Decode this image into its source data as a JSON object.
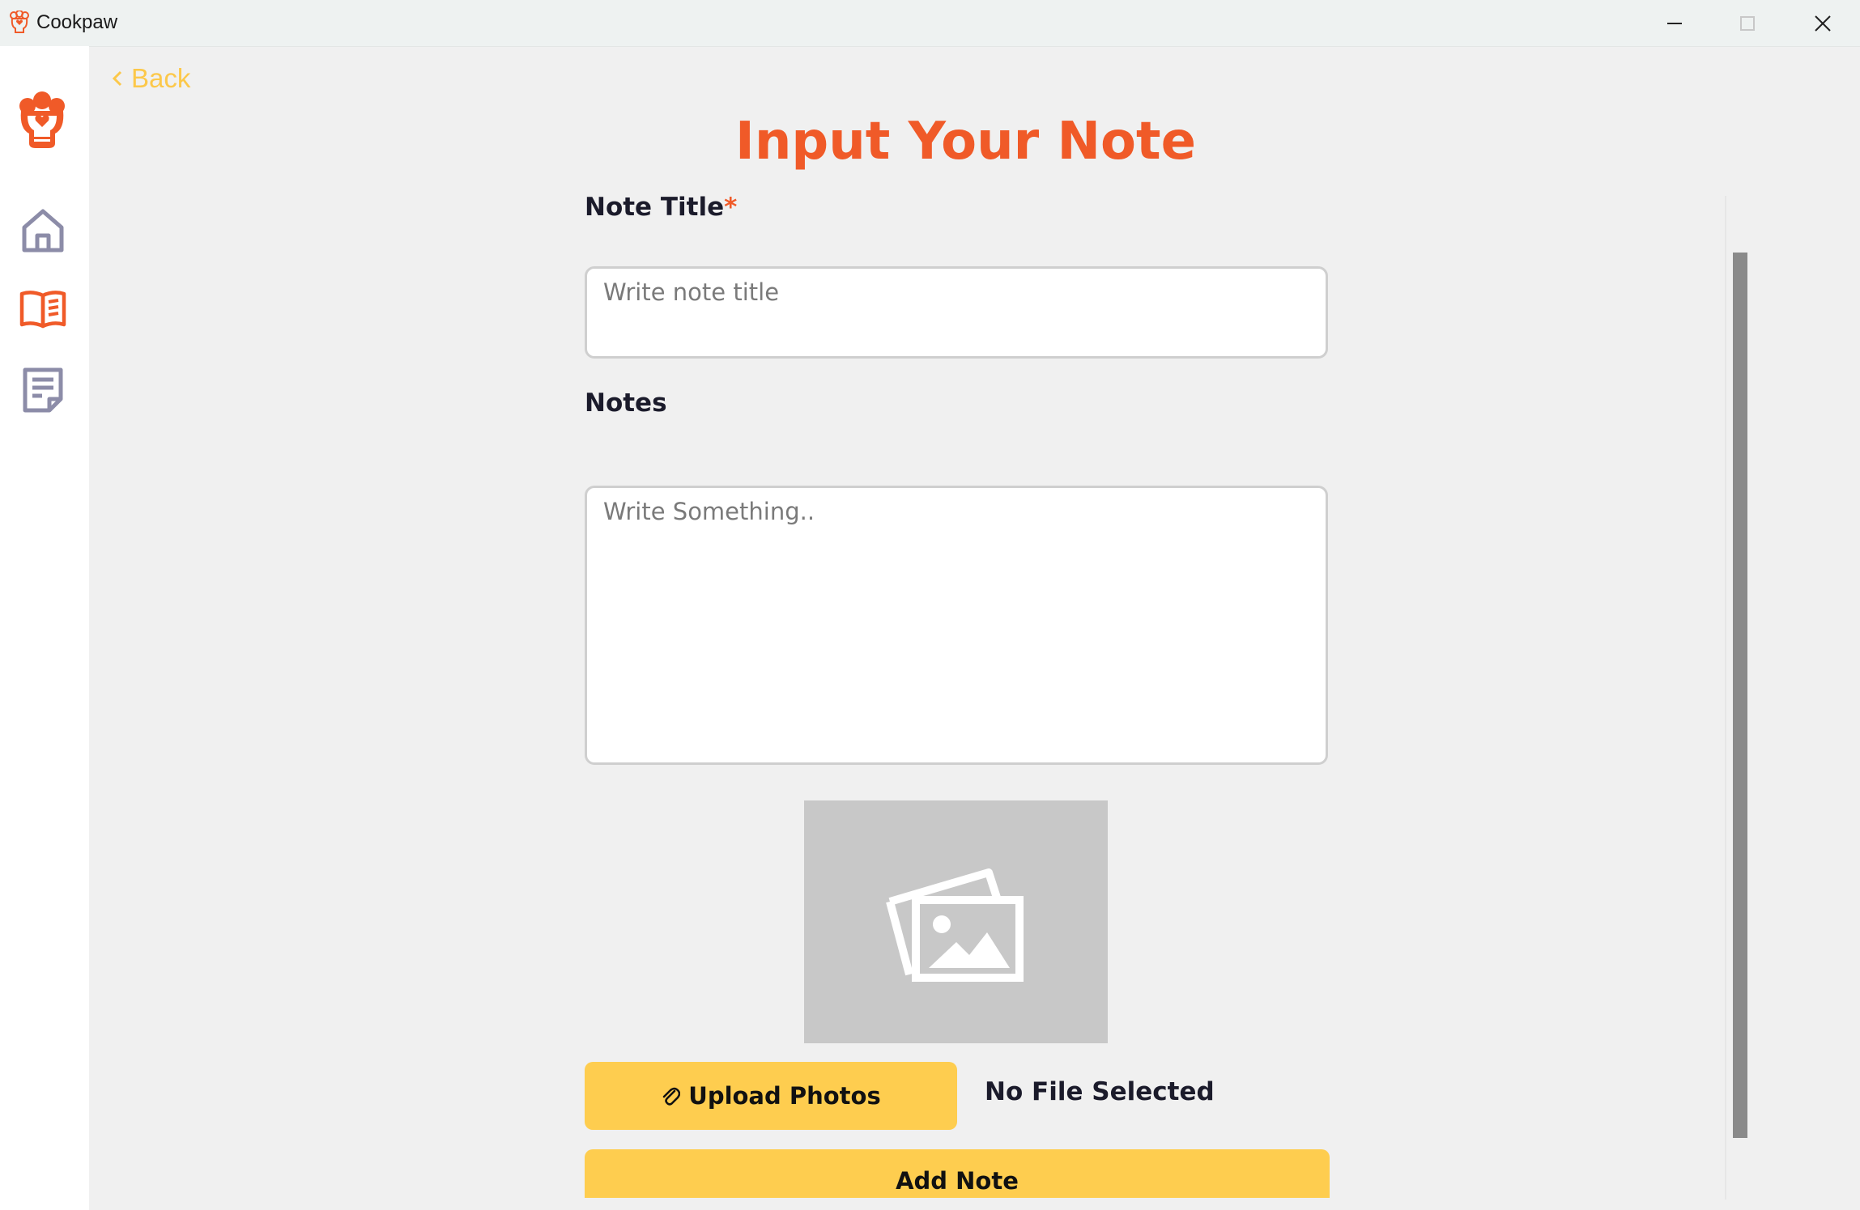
{
  "window": {
    "title": "Cookpaw"
  },
  "nav": {
    "back_label": "Back",
    "items": [
      {
        "name": "home",
        "icon": "home-icon"
      },
      {
        "name": "recipes",
        "icon": "open-book-icon"
      },
      {
        "name": "notes",
        "icon": "notes-icon"
      }
    ]
  },
  "form": {
    "heading": "Input Your Note",
    "title_label": "Note Title",
    "required_mark": "*",
    "title_placeholder": "Write note title",
    "notes_label": "Notes",
    "notes_placeholder": "Write Something..",
    "upload_label": "Upload Photos",
    "file_status": "No File Selected",
    "submit_label": "Add Note"
  },
  "colors": {
    "accent_orange": "#f05a28",
    "accent_yellow": "#fecd4f",
    "back_yellow": "#fcc84a",
    "nav_gray": "#8c8ca8"
  }
}
